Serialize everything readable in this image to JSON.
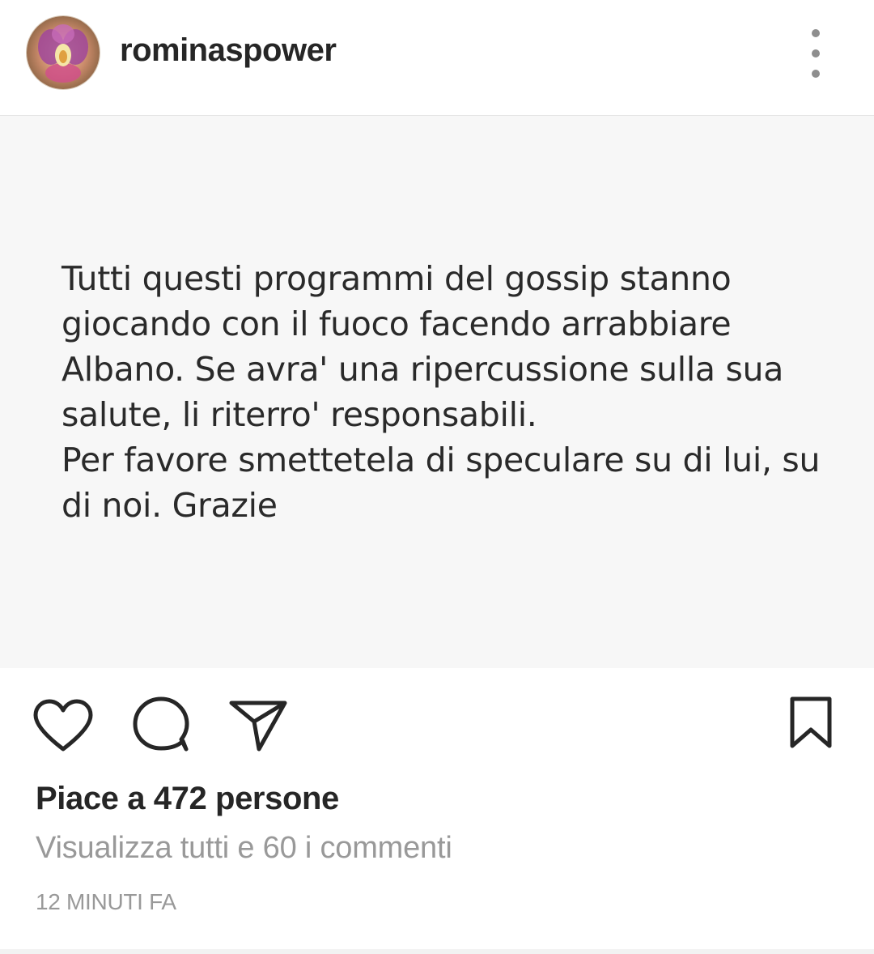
{
  "post": {
    "username": "rominaspower",
    "avatar_icon": "flower-avatar",
    "more_icon": "more-vertical-icon",
    "text": "Tutti questi programmi del gossip stanno\ngiocando con il fuoco facendo arrabbiare\nAlbano. Se avra' una ripercussione sulla sua\nsalute, li riterro' responsabili.\nPer favore smettetela di speculare su di lui, su\ndi noi. Grazie",
    "likes": "Piace a 472 persone",
    "comments_link": "Visualizza tutti e 60 i commenti",
    "timestamp": "12 MINUTI FA"
  },
  "actions": {
    "like_icon": "heart-icon",
    "comment_icon": "comment-icon",
    "share_icon": "send-icon",
    "save_icon": "bookmark-icon"
  },
  "colors": {
    "text_primary": "#262626",
    "text_secondary": "#999999",
    "image_background": "#f7f7f7"
  }
}
